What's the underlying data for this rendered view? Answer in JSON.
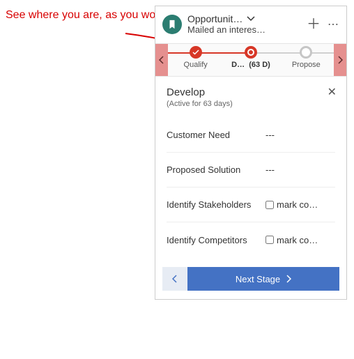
{
  "annotation": "See where you are, as you work on a record",
  "header": {
    "title": "Opportunit…",
    "subtitle": "Mailed an interes…"
  },
  "stages": [
    {
      "label": "Qualify",
      "status": "done"
    },
    {
      "label": "D…",
      "days": "(63 D)",
      "status": "active"
    },
    {
      "label": "Propose",
      "status": "future"
    }
  ],
  "section": {
    "title": "Develop",
    "subtitle": "(Active for 63 days)"
  },
  "fields": [
    {
      "label": "Customer Need",
      "value": "---",
      "checkbox": false
    },
    {
      "label": "Proposed Solution",
      "value": "---",
      "checkbox": false
    },
    {
      "label": "Identify Stakeholders",
      "value": "mark co…",
      "checkbox": true
    },
    {
      "label": "Identify Competitors",
      "value": "mark co…",
      "checkbox": true
    }
  ],
  "footer": {
    "next_label": "Next Stage"
  }
}
